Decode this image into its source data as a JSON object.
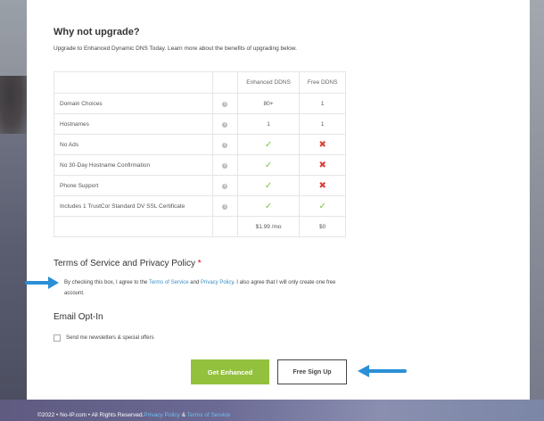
{
  "upgrade": {
    "title": "Why not upgrade?",
    "intro": "Upgrade to Enhanced Dynamic DNS Today. Learn more about the benefits of upgrading below."
  },
  "table": {
    "headers": [
      "Enhanced DDNS",
      "Free DDNS"
    ],
    "rows": [
      {
        "feature": "Domain Choices",
        "enhanced": "80+",
        "free": "1"
      },
      {
        "feature": "Hostnames",
        "enhanced": "1",
        "free": "1"
      },
      {
        "feature": "No Ads",
        "enhanced": "check",
        "free": "cross"
      },
      {
        "feature": "No 30-Day Hostname Confirmation",
        "enhanced": "check",
        "free": "cross"
      },
      {
        "feature": "Phone Support",
        "enhanced": "check",
        "free": "cross"
      },
      {
        "feature": "Includes 1 TrustCor Standard DV SSL Certificate",
        "enhanced": "check",
        "free": "check"
      }
    ],
    "prices": {
      "enhanced": "$1.99 /mo",
      "free": "$0"
    }
  },
  "tos": {
    "title": "Terms of Service and Privacy Policy",
    "required_mark": "*",
    "text_before": "By checking this box, I agree to the ",
    "tos_link": "Terms of Service",
    "and": " and ",
    "privacy_link": "Privacy Policy",
    "text_after": ". I also agree that I will only create one free account."
  },
  "email": {
    "title": "Email Opt-In",
    "checkbox_label": "Send me newsletters & special offers"
  },
  "buttons": {
    "enhanced": "Get Enhanced",
    "free": "Free Sign Up"
  },
  "footer": {
    "copyright": "©2022 • No-IP.com • All Rights Reserved.",
    "privacy_link": "Privacy Policy",
    "amp": " & ",
    "tos_link": "Terms of Service"
  },
  "icons": {
    "info": "info-icon",
    "check": "checkmark-icon",
    "cross": "cross-icon",
    "arrow": "arrow-right-icon"
  },
  "colors": {
    "accent_green": "#93c13d",
    "check_green": "#7cc440",
    "cross_red": "#d9413a",
    "link_blue": "#3a8fc4",
    "arrow_blue": "#2b8fd6"
  }
}
